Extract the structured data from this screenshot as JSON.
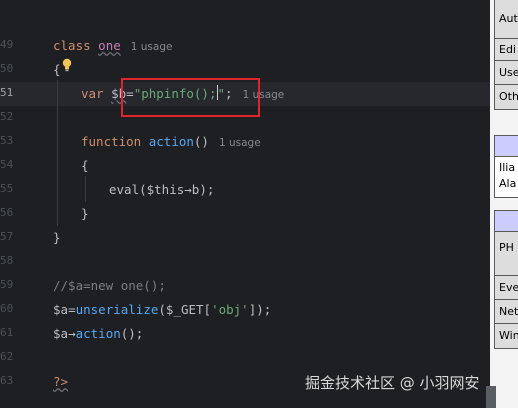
{
  "editor": {
    "line_numbers": [
      "",
      "49",
      "50",
      "51",
      "52",
      "53",
      "54",
      "55",
      "56",
      "57",
      "58",
      "59",
      "60",
      "61",
      "62",
      "63",
      ""
    ],
    "class_kw": "class",
    "class_name": "one",
    "usage_hint": "1 usage",
    "open_brace": "{",
    "var_kw": "var",
    "var_name": "$b",
    "assign": "=",
    "string_value": "\"phpinfo();",
    "string_end": "\"",
    "semicolon": ";",
    "function_kw": "function",
    "method_name": "action",
    "parens": "()",
    "eval_call": "eval",
    "eval_args": "($this→b);",
    "close_brace": "}",
    "comment": "//$a=new one();",
    "line60_var": "$a",
    "line60_eq": "=",
    "line60_fn": "unserialize",
    "line60_args_open": "($_GET[",
    "line60_key": "'obj'",
    "line60_args_close": "]);",
    "line61_var": "$a",
    "line61_arrow": "→",
    "line61_method": "action",
    "line61_end": "();",
    "php_close": "?>"
  },
  "watermark": {
    "text": "掘金技术社区 @ 小羽网安"
  },
  "right_panel": {
    "box1": [
      "Aut",
      "Edi",
      "Use",
      "Oth"
    ],
    "box2": [
      "Ilia",
      "Ala"
    ],
    "box3": [
      "PH",
      "Eve",
      "Net",
      "Win"
    ]
  }
}
